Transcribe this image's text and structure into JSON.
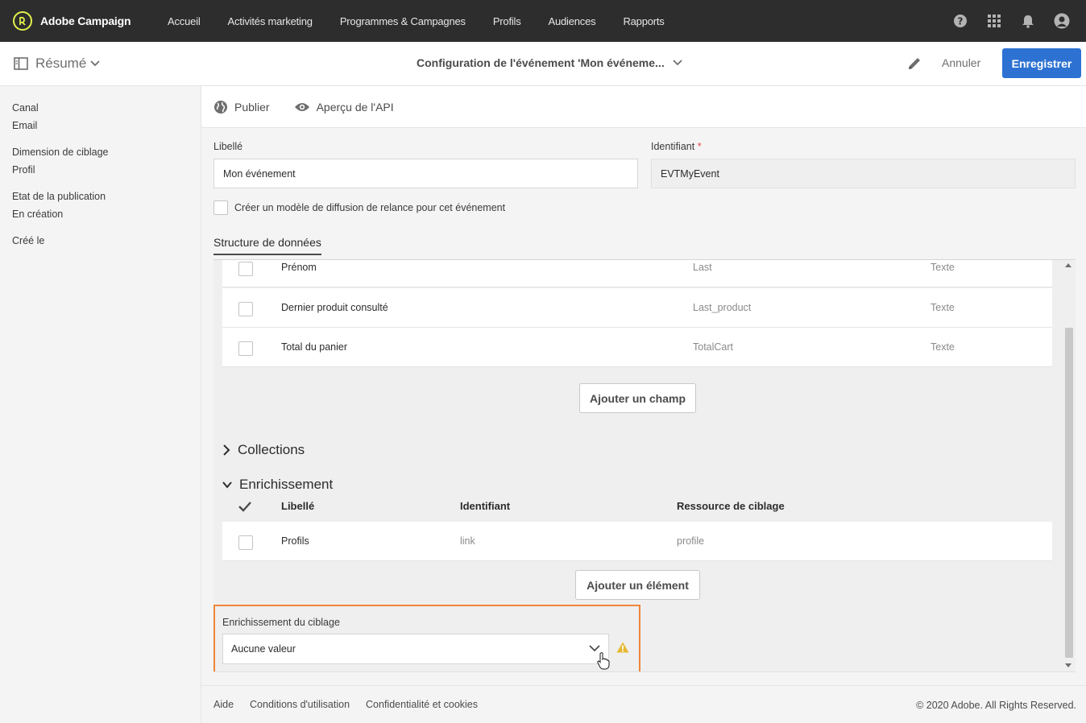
{
  "app": {
    "name": "Adobe Campaign",
    "logo": "adobe-campaign-logo"
  },
  "topnav": {
    "items": [
      {
        "label": "Accueil"
      },
      {
        "label": "Activités marketing"
      },
      {
        "label": "Programmes & Campagnes"
      },
      {
        "label": "Profils"
      },
      {
        "label": "Audiences"
      },
      {
        "label": "Rapports"
      }
    ],
    "icons": [
      "help-icon",
      "apps-grid-icon",
      "bell-icon",
      "user-avatar-icon"
    ]
  },
  "header": {
    "summary_label": "Résumé",
    "title": "Configuration de l'événement 'Mon événeme...",
    "cancel_label": "Annuler",
    "save_label": "Enregistrer",
    "accent": "#2d72d2"
  },
  "sidebar": {
    "groups": [
      {
        "label": "Canal",
        "value": "Email"
      },
      {
        "label": "Dimension de ciblage",
        "value": "Profil"
      },
      {
        "label": "Etat de la publication",
        "value": "En création"
      },
      {
        "label": "Créé le",
        "value": ""
      }
    ]
  },
  "actions": {
    "publish_label": "Publier",
    "api_label": "Aperçu de l'API"
  },
  "form": {
    "label_field": {
      "label": "Libellé",
      "value": "Mon événement"
    },
    "id_field": {
      "label": "Identifiant",
      "required_mark": "*",
      "value": "EVTMyEvent"
    },
    "reminder_checkbox": {
      "label": "Créer un modèle de diffusion de relance pour cet événement",
      "checked": false
    }
  },
  "tabs": {
    "data_structure": "Structure de données"
  },
  "fields": {
    "rows": [
      {
        "label": "Prénom",
        "id": "Last",
        "type": "Texte"
      },
      {
        "label": "Dernier produit consulté",
        "id": "Last_product",
        "type": "Texte"
      },
      {
        "label": "Total du panier",
        "id": "TotalCart",
        "type": "Texte"
      }
    ],
    "add_label": "Ajouter un champ"
  },
  "collections": {
    "title": "Collections",
    "expanded": false
  },
  "enrichment": {
    "title": "Enrichissement",
    "expanded": true,
    "headers": {
      "label": "Libellé",
      "id": "Identifiant",
      "resource": "Ressource de ciblage"
    },
    "rows": [
      {
        "label": "Profils",
        "id": "link",
        "resource": "profile"
      }
    ],
    "add_label": "Ajouter un élément"
  },
  "targeting_enrichment": {
    "label": "Enrichissement du ciblage",
    "value": "Aucune valeur",
    "warning_icon": "warning-icon",
    "highlight_color": "#f0853a"
  },
  "footer": {
    "links": [
      "Aide",
      "Conditions d'utilisation",
      "Confidentialité et cookies"
    ],
    "copyright": "© 2020 Adobe. All Rights Reserved."
  }
}
